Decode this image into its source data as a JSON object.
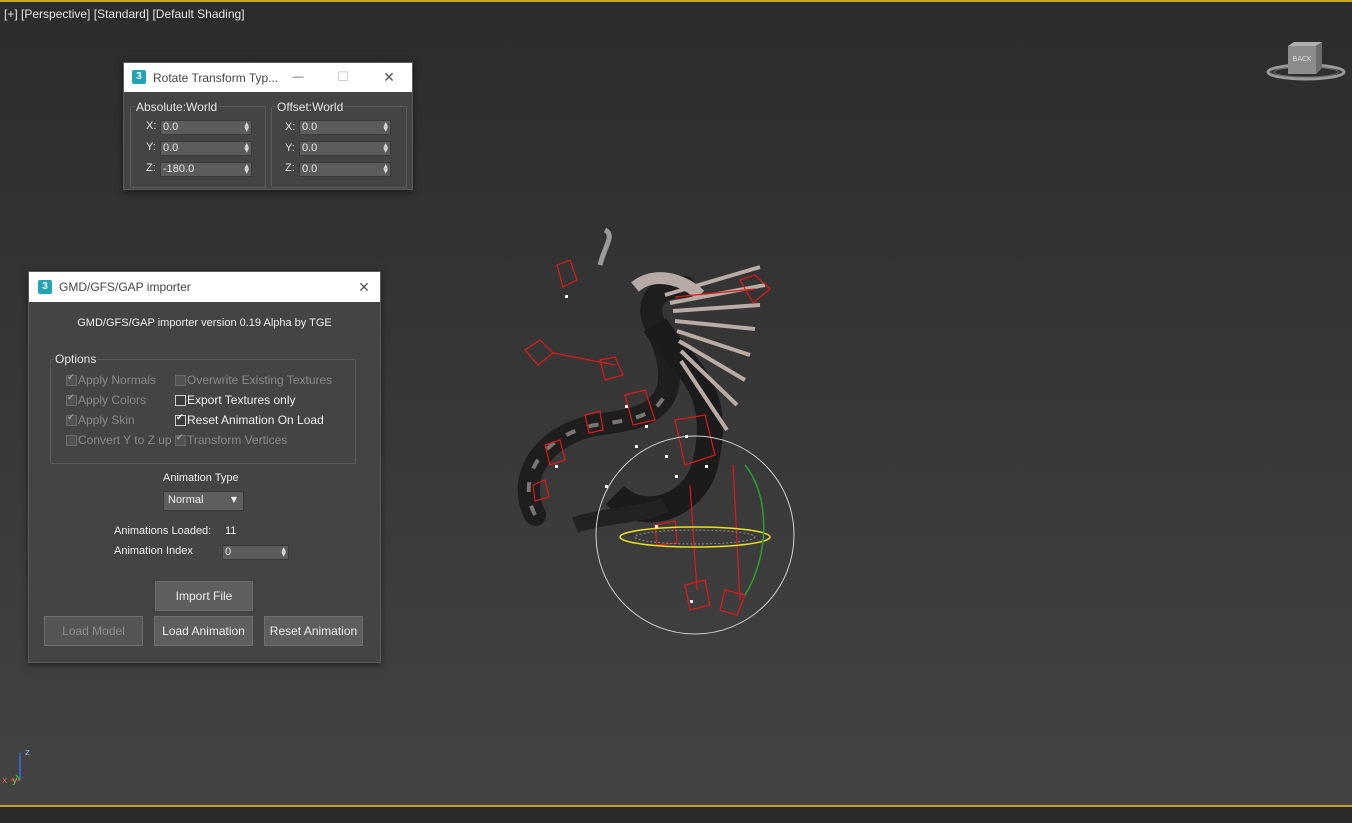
{
  "viewport": {
    "labels": [
      "[+]",
      "[Perspective]",
      "[Standard]",
      "[Default Shading]"
    ],
    "viewcube_face": "BACK",
    "gizmo_axes": {
      "x": "x",
      "y": "y",
      "z": "z"
    }
  },
  "rotate_window": {
    "title": "Rotate Transform Typ...",
    "minimize_icon": "—",
    "maximize_icon": "☐",
    "close_icon": "✕",
    "absolute": {
      "label": "Absolute:World",
      "x_label": "X:",
      "y_label": "Y:",
      "z_label": "Z:",
      "x": "0.0",
      "y": "0.0",
      "z": "-180.0"
    },
    "offset": {
      "label": "Offset:World",
      "x_label": "X:",
      "y_label": "Y:",
      "z_label": "Z:",
      "x": "0.0",
      "y": "0.0",
      "z": "0.0"
    }
  },
  "importer": {
    "title": "GMD/GFS/GAP importer",
    "close_icon": "✕",
    "version_text": "GMD/GFS/GAP importer version 0.19 Alpha by TGE",
    "options_label": "Options",
    "options": {
      "apply_normals": {
        "label": "Apply Normals",
        "checked": true,
        "enabled": false
      },
      "apply_colors": {
        "label": "Apply Colors",
        "checked": true,
        "enabled": false
      },
      "apply_skin": {
        "label": "Apply Skin",
        "checked": true,
        "enabled": false
      },
      "convert_y_to_z": {
        "label": "Convert Y to Z up",
        "checked": false,
        "enabled": false
      },
      "overwrite_textures": {
        "label": "Overwrite Existing Textures",
        "checked": false,
        "enabled": false
      },
      "export_textures": {
        "label": "Export Textures only",
        "checked": false,
        "enabled": true
      },
      "reset_animation": {
        "label": "Reset Animation On Load",
        "checked": true,
        "enabled": true
      },
      "transform_vertices": {
        "label": "Transform Vertices",
        "checked": true,
        "enabled": false
      }
    },
    "animation_type_label": "Animation Type",
    "animation_type_value": "Normal",
    "animations_loaded_label": "Animations Loaded:",
    "animations_loaded_value": "11",
    "animation_index_label": "Animation Index",
    "animation_index_value": "0",
    "buttons": {
      "import_file": "Import File",
      "load_model": "Load Model",
      "load_animation": "Load Animation",
      "reset_animation": "Reset Animation"
    }
  },
  "colors": {
    "accent_line": "#c9a227",
    "app_icon": "#22a3b6",
    "bone": "#e01818",
    "gizmo_circle": "#d0d0d0"
  }
}
